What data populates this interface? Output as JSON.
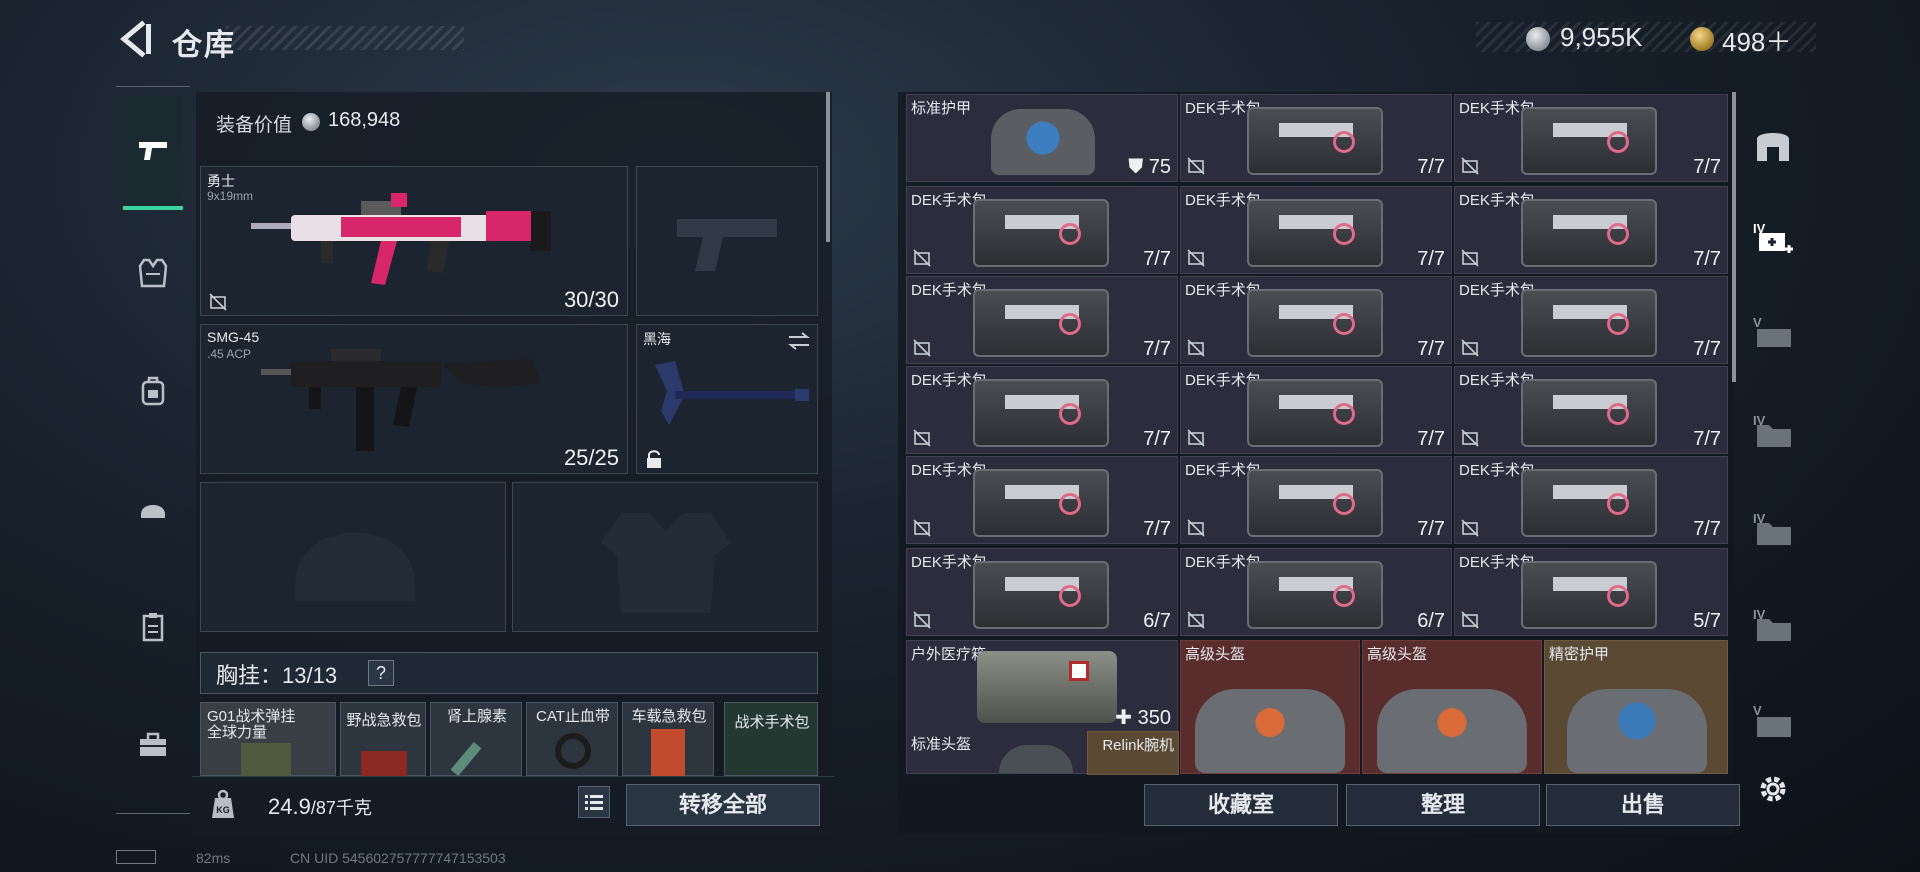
{
  "header": {
    "title": "仓库",
    "currency_silver": "9,955K",
    "currency_gold": "498＋"
  },
  "left_nav": {
    "items": [
      "pistol-icon",
      "vest-icon",
      "backpack-icon",
      "helmet-icon",
      "clipboard-icon",
      "toolbox-icon"
    ]
  },
  "equipment": {
    "value_label": "装备价值",
    "value": "168,948",
    "primary": {
      "name": "勇士",
      "caliber": "9x19mm",
      "ammo": "30/30"
    },
    "secondary": {
      "name": "SMG-45",
      "caliber": ".45 ACP",
      "ammo": "25/25"
    },
    "melee": {
      "name": "黑海"
    },
    "chest_label": "胸挂：13/13",
    "chest_help": "?",
    "chest_items": [
      {
        "name": "G01战术弹挂",
        "sub": "全球力量"
      },
      {
        "name": "野战急救包"
      },
      {
        "name": "肾上腺素"
      },
      {
        "name": "CAT止血带"
      },
      {
        "name": "车载急救包"
      },
      {
        "name": "战术手术包"
      }
    ],
    "weight": "24.9",
    "weight_total": "/87千克",
    "transfer_all": "转移全部"
  },
  "stash": {
    "cells": [
      {
        "name": "标准护甲",
        "count": "75",
        "kind": "armor"
      },
      {
        "name": "DEK手术包",
        "count": "7/7"
      },
      {
        "name": "DEK手术包",
        "count": "7/7"
      },
      {
        "name": "DEK手术包",
        "count": "7/7"
      },
      {
        "name": "DEK手术包",
        "count": "7/7"
      },
      {
        "name": "DEK手术包",
        "count": "7/7"
      },
      {
        "name": "DEK手术包",
        "count": "7/7"
      },
      {
        "name": "DEK手术包",
        "count": "7/7"
      },
      {
        "name": "DEK手术包",
        "count": "7/7"
      },
      {
        "name": "DEK手术包",
        "count": "7/7"
      },
      {
        "name": "DEK手术包",
        "count": "7/7"
      },
      {
        "name": "DEK手术包",
        "count": "7/7"
      },
      {
        "name": "DEK手术包",
        "count": "7/7"
      },
      {
        "name": "DEK手术包",
        "count": "7/7"
      },
      {
        "name": "DEK手术包",
        "count": "7/7"
      },
      {
        "name": "DEK手术包",
        "count": "6/7"
      },
      {
        "name": "DEK手术包",
        "count": "6/7"
      },
      {
        "name": "DEK手术包",
        "count": "5/7"
      }
    ],
    "bottom_items": [
      {
        "name": "户外医疗箱",
        "count": "350"
      },
      {
        "name": "高级头盔"
      },
      {
        "name": "高级头盔"
      },
      {
        "name": "精密护甲"
      },
      {
        "name": "标准头盔"
      },
      {
        "name": "Relink腕机"
      }
    ],
    "buttons": {
      "collection": "收藏室",
      "sort": "整理",
      "sell": "出售"
    }
  },
  "right_nav": {
    "levels": [
      "IV",
      "V",
      "IV",
      "IV",
      "IV",
      "V"
    ]
  },
  "status": {
    "ping": "82ms",
    "uid": "CN UID 545602757777747153503"
  },
  "colors": {
    "accent": "#3fd1a0",
    "rare_red": "#5a2d2d",
    "rare_gold": "#5a4a34"
  }
}
